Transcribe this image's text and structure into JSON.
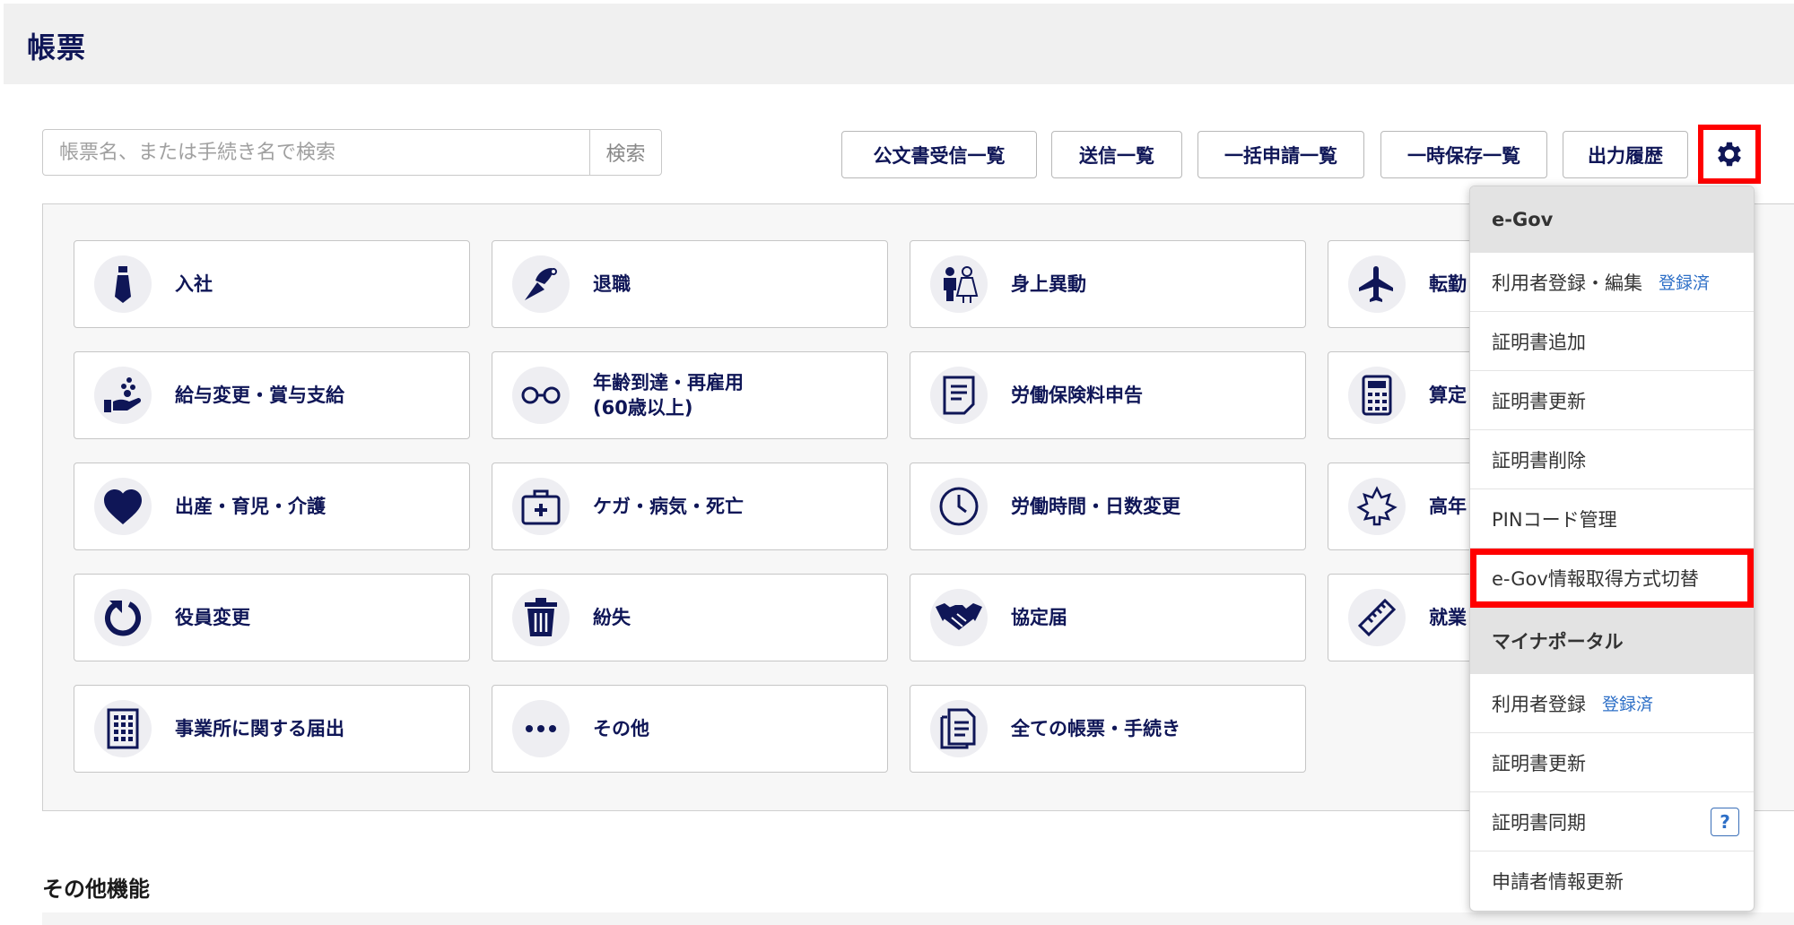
{
  "header": {
    "title": "帳票"
  },
  "search": {
    "placeholder": "帳票名、または手続き名で検索",
    "button": "検索"
  },
  "toolbar": {
    "buttons": [
      "公文書受信一覧",
      "送信一覧",
      "一括申請一覧",
      "一時保存一覧",
      "出力履歴"
    ]
  },
  "cards": [
    {
      "label": "入社",
      "icon": "necktie-icon"
    },
    {
      "label": "退職",
      "icon": "bouquet-icon"
    },
    {
      "label": "身上異動",
      "icon": "couple-icon"
    },
    {
      "label": "転勤",
      "icon": "airplane-icon"
    },
    {
      "label": "給与変更・賞与支給",
      "icon": "hand-coins-icon"
    },
    {
      "label": "年齢到達・再雇用\n(60歳以上)",
      "icon": "glasses-icon"
    },
    {
      "label": "労働保険料申告",
      "icon": "document-icon"
    },
    {
      "label": "算定",
      "icon": "calculator-icon"
    },
    {
      "label": "出産・育児・介護",
      "icon": "heart-icon"
    },
    {
      "label": "ケガ・病気・死亡",
      "icon": "first-aid-icon"
    },
    {
      "label": "労働時間・日数変更",
      "icon": "clock-icon"
    },
    {
      "label": "高年",
      "icon": "maple-leaf-icon"
    },
    {
      "label": "役員変更",
      "icon": "rotate-icon"
    },
    {
      "label": "紛失",
      "icon": "trash-icon"
    },
    {
      "label": "協定届",
      "icon": "handshake-icon"
    },
    {
      "label": "就業",
      "icon": "ruler-icon"
    },
    {
      "label": "事業所に関する届出",
      "icon": "building-icon"
    },
    {
      "label": "その他",
      "icon": "ellipsis-icon"
    },
    {
      "label": "全ての帳票・手続き",
      "icon": "documents-icon"
    }
  ],
  "other": {
    "title": "その他機能"
  },
  "menu": {
    "egov": {
      "title": "e-Gov",
      "items": [
        {
          "label": "利用者登録・編集",
          "status": "登録済"
        },
        {
          "label": "証明書追加"
        },
        {
          "label": "証明書更新"
        },
        {
          "label": "証明書削除"
        },
        {
          "label": "PINコード管理"
        },
        {
          "label": "e-Gov情報取得方式切替"
        }
      ]
    },
    "myna": {
      "title": "マイナポータル",
      "items": [
        {
          "label": "利用者登録",
          "status": "登録済"
        },
        {
          "label": "証明書更新"
        },
        {
          "label": "証明書同期",
          "help": "?"
        },
        {
          "label": "申請者情報更新"
        }
      ]
    }
  },
  "colors": {
    "primary": "#0f1657",
    "highlight": "#ff0000",
    "link": "#2d6fc7"
  }
}
